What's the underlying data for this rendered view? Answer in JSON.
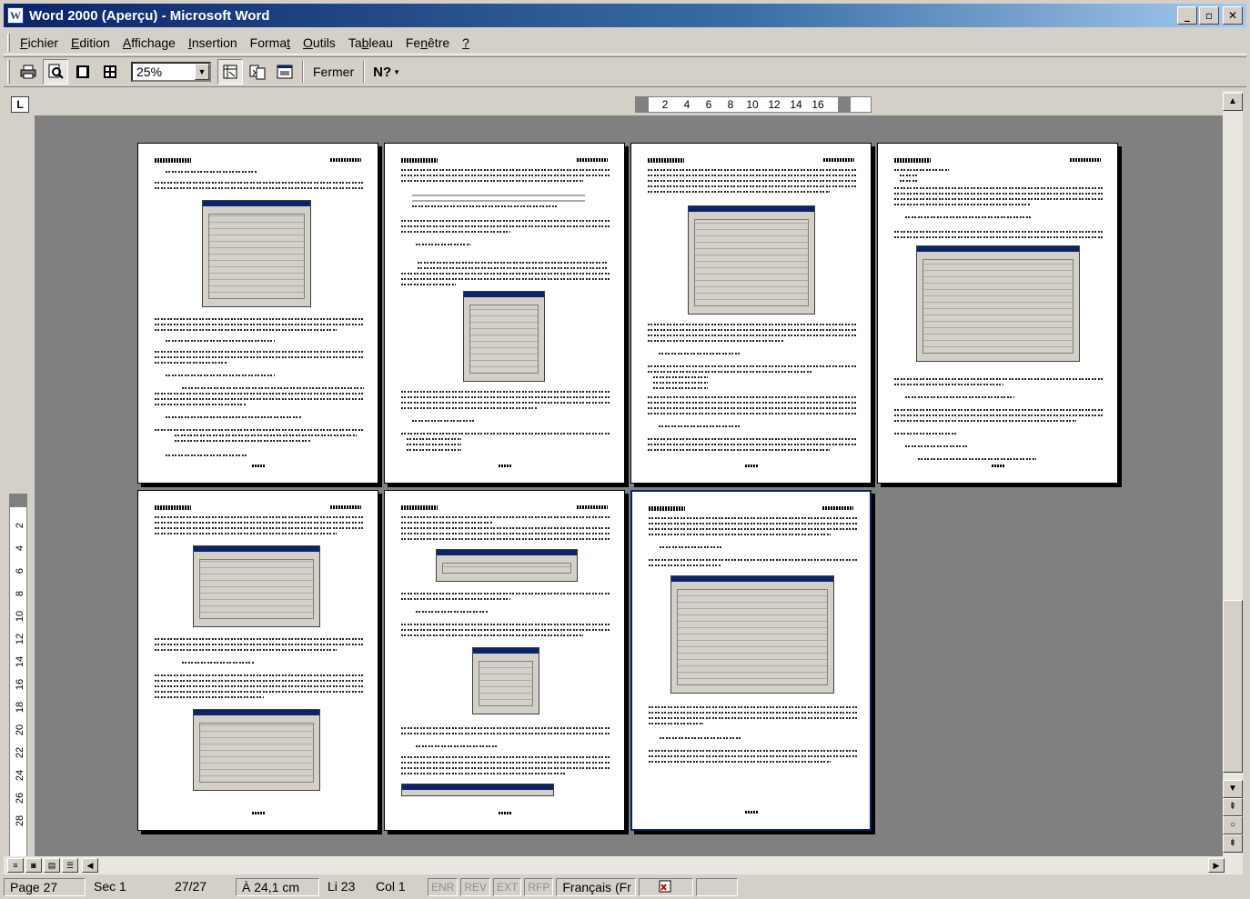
{
  "window": {
    "title": "Word 2000 (Aperçu) - Microsoft Word",
    "min": "_",
    "max": "▫",
    "close": "✕"
  },
  "menu": [
    "Fichier",
    "Edition",
    "Affichage",
    "Insertion",
    "Format",
    "Outils",
    "Tableau",
    "Fenêtre",
    "?"
  ],
  "menu_access": [
    "F",
    "E",
    "A",
    "I",
    "t",
    "O",
    "b",
    "n",
    "?"
  ],
  "toolbar": {
    "print": "print-icon",
    "zoom_value": "25%",
    "close_label": "Fermer",
    "help": "N?"
  },
  "ruler": {
    "corner": "L",
    "marks": [
      "2",
      "4",
      "6",
      "8",
      "10",
      "12",
      "14",
      "16"
    ]
  },
  "vruler": {
    "marks": [
      "2",
      "4",
      "6",
      "8",
      "10",
      "12",
      "14",
      "16",
      "18",
      "20",
      "22",
      "24",
      "26",
      "28"
    ]
  },
  "status": {
    "page": "Page 27",
    "sec": "Sec 1",
    "count": "27/27",
    "at": "À 24,1 cm",
    "line": "Li 23",
    "col": "Col 1",
    "enr": "ENR",
    "rev": "REV",
    "ext": "EXT",
    "rfp": "RFP",
    "lang": "Français (Fr"
  }
}
